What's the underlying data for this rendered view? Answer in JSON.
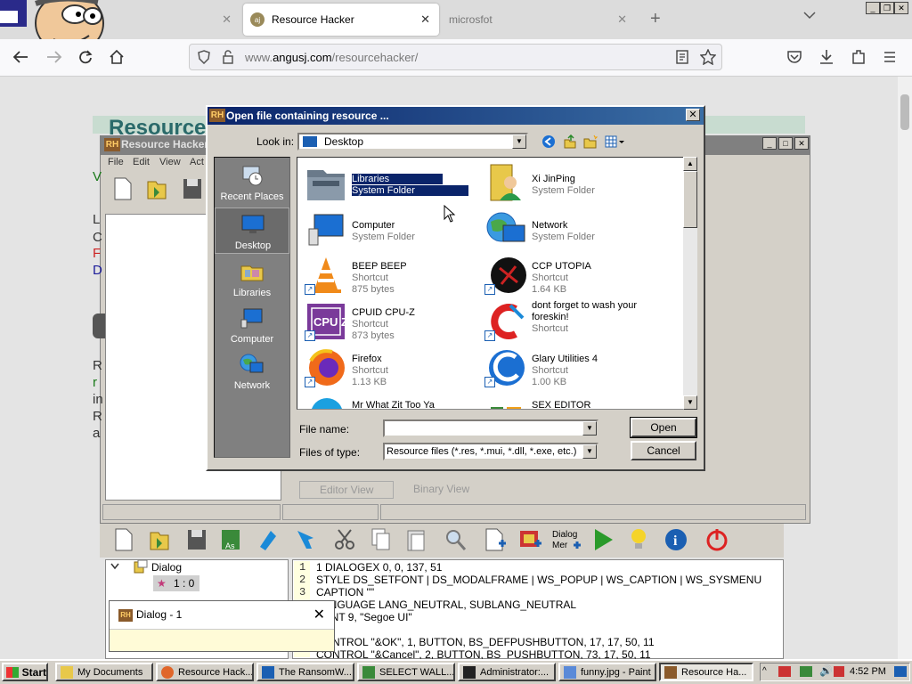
{
  "browser": {
    "tabs": [
      {
        "label": "",
        "active": false
      },
      {
        "label": "Resource Hacker",
        "favicon_text": "aj",
        "active": true
      },
      {
        "label": "microsfot",
        "active": false
      }
    ],
    "url": {
      "prefix": "www.",
      "domain": "angusj.com",
      "path": "/resourcehacker/"
    },
    "new_tab_glyph": "+",
    "tab_close_glyph": "✕"
  },
  "webpage": {
    "banner_text": "Resource"
  },
  "rh_window": {
    "title": "Resource Hacker",
    "menu": [
      "File",
      "Edit",
      "View",
      "Act"
    ],
    "side_letters": [
      {
        "text": "V",
        "color": "#1a7a1a"
      },
      {
        "text": "L",
        "color": "#333333"
      },
      {
        "text": "C",
        "color": "#333333"
      },
      {
        "text": "F",
        "color": "#cc2222"
      },
      {
        "text": "D",
        "color": "#1a1a99"
      }
    ],
    "side_letters2": [
      {
        "text": "R",
        "color": "#333333"
      },
      {
        "text": "r",
        "color": "#1a7a1a"
      },
      {
        "text": "in",
        "color": "#333333"
      },
      {
        "text": "R",
        "color": "#333333"
      },
      {
        "text": "a",
        "color": "#333333"
      }
    ],
    "editor_tabs": [
      "Editor View",
      "Binary View"
    ]
  },
  "tree": {
    "root": "Dialog",
    "child": "1 : 0"
  },
  "code": {
    "lines": [
      {
        "n": "1",
        "text": "1 DIALOGEX 0, 0, 137, 51"
      },
      {
        "n": "2",
        "text": "STYLE DS_SETFONT | DS_MODALFRAME | WS_POPUP | WS_CAPTION | WS_SYSMENU"
      },
      {
        "n": "3",
        "text": "CAPTION \"\""
      },
      {
        "n": "",
        "text": "LANGUAGE LANG_NEUTRAL, SUBLANG_NEUTRAL"
      },
      {
        "n": "",
        "text": "FONT 9, \"Segoe UI\""
      },
      {
        "n": "",
        "text": ""
      },
      {
        "n": "",
        "text": "CONTROL \"&OK\", 1, BUTTON, BS_DEFPUSHBUTTON, 17, 17, 50, 11"
      },
      {
        "n": "",
        "text": "CONTROL \"&Cancel\", 2, BUTTON, BS_PUSHBUTTON, 73, 17, 50, 11"
      }
    ]
  },
  "dialog_preview": {
    "title": "Dialog - 1",
    "close": "✕"
  },
  "open_dialog": {
    "title": "Open file containing resource ...",
    "look_in_label": "Look in:",
    "look_in_value": "Desktop",
    "places": [
      {
        "label": "Recent Places",
        "icon": "recent-places-icon"
      },
      {
        "label": "Desktop",
        "icon": "desktop-icon"
      },
      {
        "label": "Libraries",
        "icon": "libraries-icon"
      },
      {
        "label": "Computer",
        "icon": "computer-icon"
      },
      {
        "label": "Network",
        "icon": "network-icon"
      }
    ],
    "files": [
      {
        "name": "Libraries",
        "line2": "System Folder",
        "line3": "",
        "icon": "libraries-folder-icon",
        "shortcut": false,
        "selected": true
      },
      {
        "name": "Xi JinPing",
        "line2": "System Folder",
        "line3": "",
        "icon": "user-folder-icon",
        "shortcut": false,
        "selected": false
      },
      {
        "name": "Computer",
        "line2": "System Folder",
        "line3": "",
        "icon": "computer-icon",
        "shortcut": false,
        "selected": false
      },
      {
        "name": "Network",
        "line2": "System Folder",
        "line3": "",
        "icon": "network-icon",
        "shortcut": false,
        "selected": false
      },
      {
        "name": "BEEP BEEP",
        "line2": "Shortcut",
        "line3": "875 bytes",
        "icon": "vlc-cone-icon",
        "shortcut": true,
        "selected": false
      },
      {
        "name": "CCP UTOPIA",
        "line2": "Shortcut",
        "line3": "1.64 KB",
        "icon": "ccp-utopia-icon",
        "shortcut": true,
        "selected": false
      },
      {
        "name": "CPUID CPU-Z",
        "line2": "Shortcut",
        "line3": "873 bytes",
        "icon": "cpu-z-icon",
        "shortcut": true,
        "selected": false
      },
      {
        "name": "dont forget to wash your",
        "name2": "foreskin!",
        "line2": "Shortcut",
        "line3": "",
        "icon": "ccleaner-icon",
        "shortcut": true,
        "selected": false
      },
      {
        "name": "Firefox",
        "line2": "Shortcut",
        "line3": "1.13 KB",
        "icon": "firefox-icon",
        "shortcut": true,
        "selected": false
      },
      {
        "name": "Glary Utilities 4",
        "line2": "Shortcut",
        "line3": "1.00 KB",
        "icon": "glary-utilities-icon",
        "shortcut": true,
        "selected": false
      },
      {
        "name": "Mr What Zit Too Ya",
        "line2": "",
        "line3": "",
        "icon": "skype-icon",
        "shortcut": false,
        "selected": false
      },
      {
        "name": "SEX EDITOR",
        "line2": "",
        "line3": "",
        "icon": "editor-icon",
        "shortcut": false,
        "selected": false
      }
    ],
    "file_name_label": "File name:",
    "file_name_value": "",
    "file_type_label": "Files of type:",
    "file_type_value": "Resource files (*.res, *.mui, *.dll, *.exe, etc.)",
    "open_label": "Open",
    "cancel_label": "Cancel",
    "close_glyph": "✕"
  },
  "taskbar": {
    "start_label": "Start",
    "items": [
      {
        "label": "My Documents",
        "active": false,
        "icon_color": "#e8c84a"
      },
      {
        "label": "Resource Hack...",
        "active": false,
        "icon_color": "#e0662a"
      },
      {
        "label": "The RansomW...",
        "active": false,
        "icon_color": "#1b5fb2"
      },
      {
        "label": "SELECT WALL...",
        "active": false,
        "icon_color": "#3a8a3a"
      },
      {
        "label": "Administrator:...",
        "active": false,
        "icon_color": "#222222"
      },
      {
        "label": "funny.jpg - Paint",
        "active": false,
        "icon_color": "#5a8ad8"
      },
      {
        "label": "Resource Ha...",
        "active": true,
        "icon_color": "#8a5a2a"
      }
    ],
    "clock": "4:52 PM"
  },
  "colors": {
    "dialog_title_start": "#0a246a",
    "dialog_title_end": "#3a6ea5",
    "selection": "#0a246a",
    "win_face": "#d4d0c8"
  }
}
